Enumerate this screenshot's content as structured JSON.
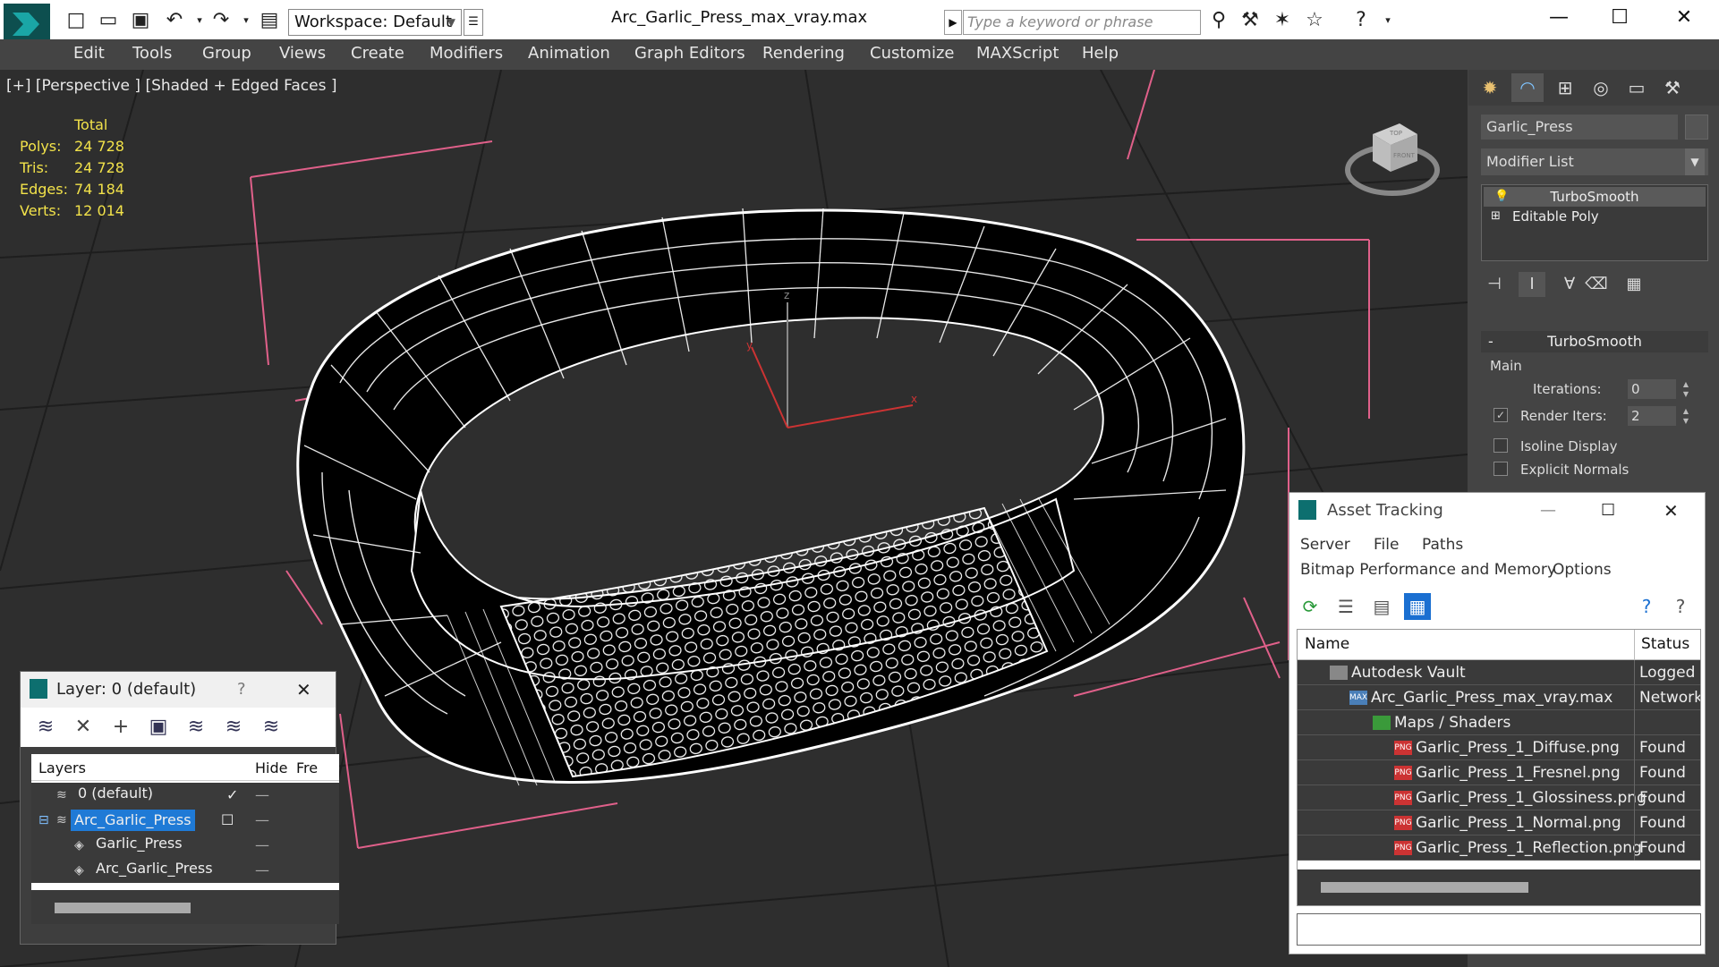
{
  "window": {
    "title": "Arc_Garlic_Press_max_vray.max",
    "workspace": "Workspace: Default",
    "search_placeholder": "Type a keyword or phrase"
  },
  "menu": [
    "Edit",
    "Tools",
    "Group",
    "Views",
    "Create",
    "Modifiers",
    "Animation",
    "Graph Editors",
    "Rendering",
    "Customize",
    "MAXScript",
    "Help"
  ],
  "viewport": {
    "label": "[+] [Perspective ] [Shaded + Edged Faces ]",
    "stats_header": "Total",
    "stats": [
      {
        "label": "Polys:",
        "value": "24 728"
      },
      {
        "label": "Tris:",
        "value": "24 728"
      },
      {
        "label": "Edges:",
        "value": "74 184"
      },
      {
        "label": "Verts:",
        "value": "12 014"
      }
    ],
    "viewcube_labels": {
      "top": "TOP",
      "front": "FRONT"
    },
    "axis_labels": {
      "x": "x",
      "y": "y",
      "z": "z"
    }
  },
  "command_panel": {
    "object_name": "Garlic_Press",
    "modifier_list": "Modifier List",
    "stack": [
      "TurboSmooth",
      "Editable Poly"
    ],
    "rollout_title": "TurboSmooth",
    "group_main": "Main",
    "iterations_label": "Iterations:",
    "iterations_value": "0",
    "render_iters_label": "Render Iters:",
    "render_iters_value": "2",
    "isoline_label": "Isoline Display",
    "explicit_normals_label": "Explicit Normals"
  },
  "layer_window": {
    "title": "Layer: 0 (default)",
    "help": "?",
    "columns": {
      "layers": "Layers",
      "hide": "Hide",
      "freeze": "Fre"
    },
    "rows": [
      {
        "name": "0 (default)"
      },
      {
        "name": "Arc_Garlic_Press"
      },
      {
        "name": "Garlic_Press"
      },
      {
        "name": "Arc_Garlic_Press"
      }
    ]
  },
  "asset_window": {
    "title": "Asset Tracking",
    "menu_row1": [
      "Server",
      "File",
      "Paths"
    ],
    "menu_row2": [
      "Bitmap Performance and Memory",
      "Options"
    ],
    "columns": {
      "name": "Name",
      "status": "Status"
    },
    "rows": [
      {
        "name": "Autodesk Vault",
        "status": "Logged Out",
        "icon": "vault-icon"
      },
      {
        "name": "Arc_Garlic_Press_max_vray.max",
        "status": "Network",
        "icon": "max-file-icon"
      },
      {
        "name": "Maps / Shaders",
        "status": "",
        "icon": "maps-folder-icon"
      },
      {
        "name": "Garlic_Press_1_Diffuse.png",
        "status": "Found",
        "icon": "png-icon"
      },
      {
        "name": "Garlic_Press_1_Fresnel.png",
        "status": "Found",
        "icon": "png-icon"
      },
      {
        "name": "Garlic_Press_1_Glossiness.png",
        "status": "Found",
        "icon": "png-icon"
      },
      {
        "name": "Garlic_Press_1_Normal.png",
        "status": "Found",
        "icon": "png-icon"
      },
      {
        "name": "Garlic_Press_1_Reflection.png",
        "status": "Found",
        "icon": "png-icon"
      }
    ]
  },
  "colors": {
    "viewport_bg": "#2e2e2e",
    "stats_text": "#f2e24a",
    "bbox_lines": "#e0608a",
    "selection": "#1f7ad6"
  }
}
